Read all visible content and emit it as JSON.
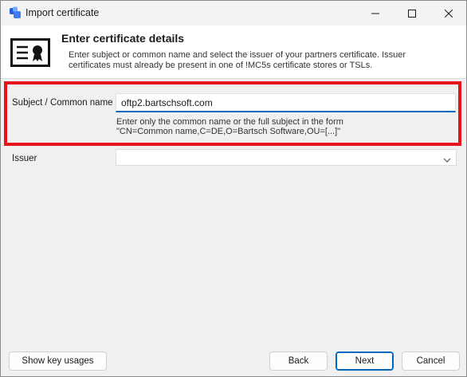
{
  "window": {
    "title": "Import certificate"
  },
  "header": {
    "title": "Enter certificate details",
    "description": "Enter subject or common name and select the issuer of your partners certificate. Issuer certificates must already be present in one of !MC5s certificate stores or TSLs."
  },
  "form": {
    "subject_label": "Subject / Common name",
    "subject_value": "oftp2.bartschsoft.com",
    "hint_line1": "Enter only the common name or the full subject in the form",
    "hint_line2": "\"CN=Common name,C=DE,O=Bartsch Software,OU=[...]\"",
    "issuer_label": "Issuer",
    "issuer_value": ""
  },
  "footer": {
    "show_key_usages": "Show key usages",
    "back": "Back",
    "next": "Next",
    "cancel": "Cancel"
  },
  "colors": {
    "accent": "#0067c0",
    "highlight": "#e8141c"
  },
  "icons": {
    "app": "app-icon",
    "certificate": "certificate-icon",
    "minimize": "minimize-icon",
    "maximize": "maximize-icon",
    "close": "close-icon",
    "dropdown": "chevron-down-icon"
  }
}
